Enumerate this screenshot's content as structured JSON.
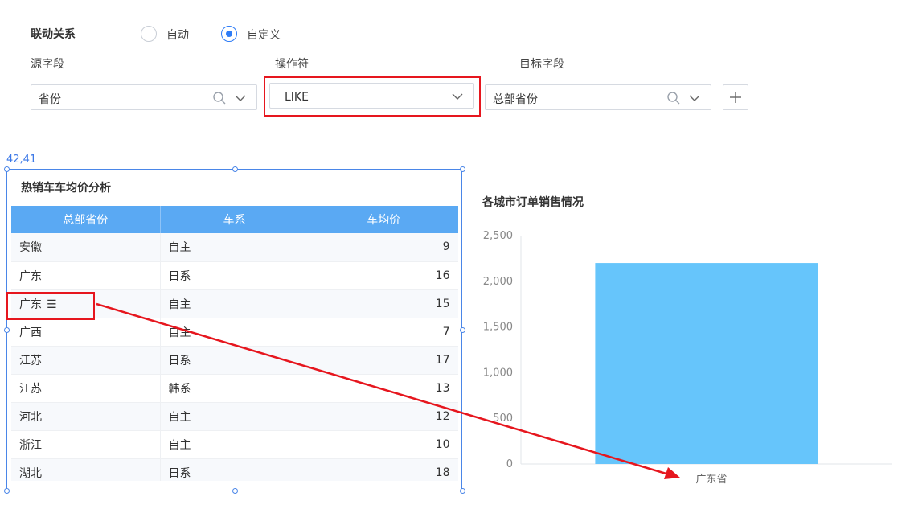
{
  "linkage": {
    "label": "联动关系",
    "radio_options": [
      {
        "label": "自动",
        "selected": false
      },
      {
        "label": "自定义",
        "selected": true
      }
    ],
    "columns": {
      "source": "源字段",
      "operator": "操作符",
      "target": "目标字段"
    },
    "source_value": "省份",
    "operator_value": "LIKE",
    "target_value": "总部省份"
  },
  "widget": {
    "coords": "42,41",
    "title": "热销车车均价分析",
    "headers": [
      "总部省份",
      "车系",
      "车均价"
    ],
    "rows": [
      [
        "安徽",
        "自主",
        "9"
      ],
      [
        "广东",
        "日系",
        "16"
      ],
      [
        "广东",
        "自主",
        "15"
      ],
      [
        "广西",
        "自主",
        "7"
      ],
      [
        "江苏",
        "日系",
        "17"
      ],
      [
        "江苏",
        "韩系",
        "13"
      ],
      [
        "河北",
        "自主",
        "12"
      ],
      [
        "浙江",
        "自主",
        "10"
      ],
      [
        "湖北",
        "日系",
        "18"
      ]
    ],
    "highlight_row": 2,
    "menu_glyph": "☰"
  },
  "chart_data": {
    "type": "bar",
    "title": "各城市订单销售情况",
    "categories": [
      "广东省"
    ],
    "values": [
      2200
    ],
    "ylim": [
      0,
      2500
    ],
    "yticks": [
      0,
      500,
      1000,
      1500,
      2000,
      2500
    ],
    "ytick_labels": [
      "0",
      "500",
      "1,000",
      "1,500",
      "2,000",
      "2,500"
    ],
    "color": "#66c5fb",
    "grid": false
  },
  "colors": {
    "accent": "#2e7cf6",
    "header": "#5aa9f3",
    "annotation": "#e6161e"
  }
}
